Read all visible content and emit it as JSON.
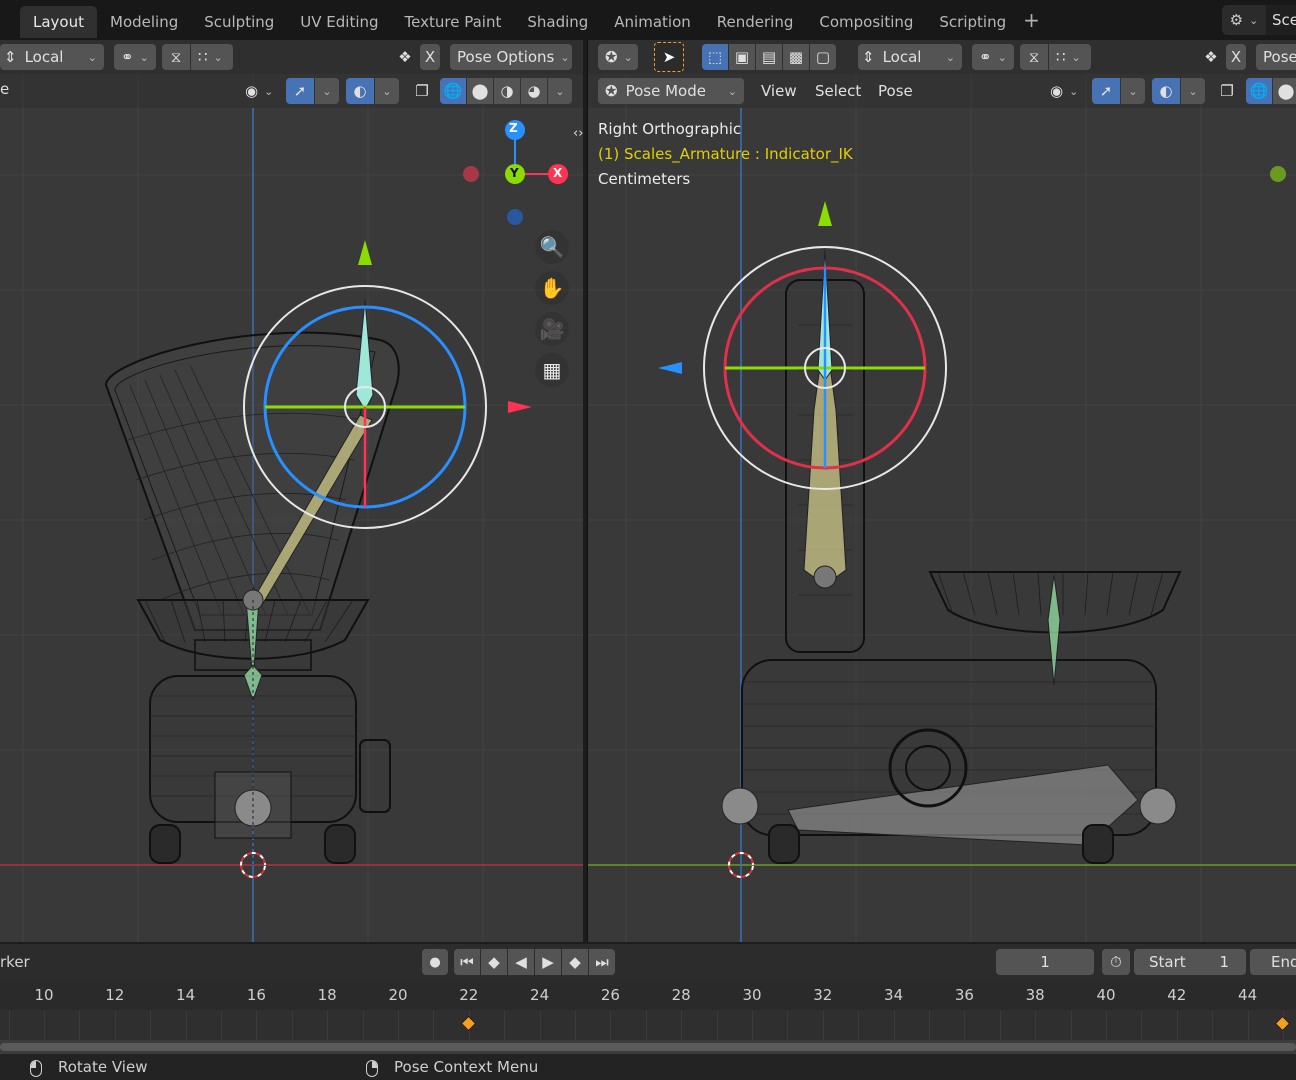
{
  "workspace_tabs": [
    {
      "label": "Layout",
      "active": true
    },
    {
      "label": "Modeling",
      "active": false
    },
    {
      "label": "Sculpting",
      "active": false
    },
    {
      "label": "UV Editing",
      "active": false
    },
    {
      "label": "Texture Paint",
      "active": false
    },
    {
      "label": "Shading",
      "active": false
    },
    {
      "label": "Animation",
      "active": false
    },
    {
      "label": "Rendering",
      "active": false
    },
    {
      "label": "Compositing",
      "active": false
    },
    {
      "label": "Scripting",
      "active": false
    }
  ],
  "workspace_add": "+",
  "scene": {
    "name": "Scene"
  },
  "left_editor": {
    "orientation_label": "Local",
    "close_symbol": "X",
    "pose_options_label": "Pose Options",
    "cut_text": "e"
  },
  "right_editor": {
    "orientation_label": "Local",
    "close_symbol": "X",
    "pose_options_label": "Pose",
    "mode_label": "Pose Mode",
    "menu": {
      "view": "View",
      "select": "Select",
      "pose": "Pose"
    },
    "overlay": {
      "view_name": "Right Orthographic",
      "active_object": "(1) Scales_Armature : Indicator_IK",
      "units": "Centimeters"
    }
  },
  "gizmo": {
    "z": "Z",
    "y": "Y",
    "x": "X"
  },
  "timeline": {
    "marker_label": "rker",
    "current_frame": "1",
    "start_label": "Start",
    "start_value": "1",
    "end_label": "End",
    "ticks": [
      10,
      12,
      14,
      16,
      18,
      20,
      22,
      24,
      26,
      28,
      30,
      32,
      34,
      36,
      38,
      40,
      42,
      44
    ],
    "keyframes": [
      22,
      45
    ]
  },
  "statusbar": {
    "left_hint": "Rotate View",
    "right_hint": "Pose Context Menu"
  },
  "colors": {
    "axis_x": "#ff3352",
    "axis_y": "#8bdc00",
    "axis_z": "#2890ff",
    "selected_text": "#e0d000",
    "keyframe": "#f0a21b"
  }
}
